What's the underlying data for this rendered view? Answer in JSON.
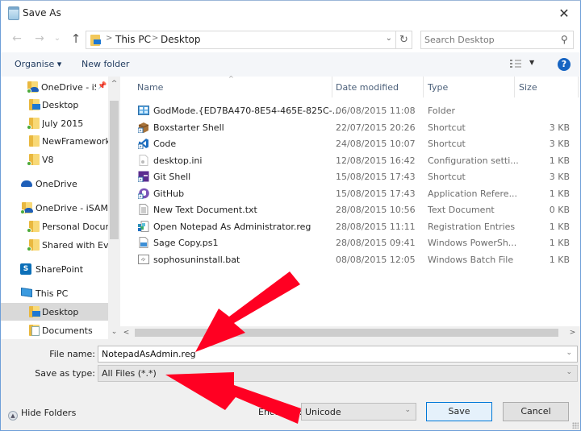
{
  "window": {
    "title": "Save As",
    "close_icon": "close-icon"
  },
  "nav": {
    "back_icon": "←",
    "forward_icon": "→",
    "recent_icon": "⌄",
    "up_icon": "↑",
    "breadcrumb": [
      "This PC",
      "Desktop"
    ],
    "breadcrumb_sep": ">",
    "address_dropdown_icon": "⌄",
    "refresh_icon": "↻",
    "search_placeholder": "Search Desktop",
    "search_icon": "⚲"
  },
  "toolbar": {
    "organise_label": "Organise ▾",
    "new_folder_label": "New folder",
    "view_dropdown_icon": "▼",
    "help_icon": "?"
  },
  "sidebar": {
    "items": [
      {
        "label": "OneDrive - iS",
        "icon": "onedrive-folder-icon",
        "pinned": true,
        "synced": true
      },
      {
        "label": "Desktop",
        "icon": "desktop-folder-icon"
      },
      {
        "label": "July 2015",
        "icon": "folder-icon",
        "synced": true
      },
      {
        "label": "NewFramework",
        "icon": "folder-icon"
      },
      {
        "label": "V8",
        "icon": "folder-icon",
        "synced": true
      },
      {
        "label": "OneDrive",
        "icon": "onedrive-cloud-icon"
      },
      {
        "label": "OneDrive - iSAMS",
        "icon": "onedrive-folder-icon",
        "synced": true
      },
      {
        "label": "Personal Documents",
        "icon": "folder-icon",
        "synced": true
      },
      {
        "label": "Shared with Everyone",
        "icon": "folder-icon",
        "synced": true
      },
      {
        "label": "SharePoint",
        "icon": "sharepoint-icon"
      },
      {
        "label": "This PC",
        "icon": "pc-icon"
      },
      {
        "label": "Desktop",
        "icon": "desktop-folder-icon",
        "selected": true
      },
      {
        "label": "Documents",
        "icon": "documents-folder-icon"
      }
    ],
    "scroll_up": "^",
    "scroll_down": "⌄"
  },
  "files": {
    "columns": {
      "name": "Name",
      "date": "Date modified",
      "type": "Type",
      "size": "Size"
    },
    "sort_indicator": "^",
    "rows": [
      {
        "name": "GodMode.{ED7BA470-8E54-465E-825C-...",
        "date": "06/08/2015 11:08",
        "type": "Folder",
        "size": "",
        "icon": "control-panel-icon"
      },
      {
        "name": "Boxstarter Shell",
        "date": "22/07/2015 20:26",
        "type": "Shortcut",
        "size": "3 KB",
        "icon": "box-shortcut-icon"
      },
      {
        "name": "Code",
        "date": "24/08/2015 10:07",
        "type": "Shortcut",
        "size": "3 KB",
        "icon": "vscode-shortcut-icon"
      },
      {
        "name": "desktop.ini",
        "date": "12/08/2015 16:42",
        "type": "Configuration setti...",
        "size": "1 KB",
        "icon": "config-file-icon"
      },
      {
        "name": "Git Shell",
        "date": "15/08/2015 17:43",
        "type": "Shortcut",
        "size": "3 KB",
        "icon": "git-shell-shortcut-icon"
      },
      {
        "name": "GitHub",
        "date": "15/08/2015 17:43",
        "type": "Application Refere...",
        "size": "1 KB",
        "icon": "github-icon"
      },
      {
        "name": "New Text Document.txt",
        "date": "28/08/2015 10:56",
        "type": "Text Document",
        "size": "0 KB",
        "icon": "text-file-icon"
      },
      {
        "name": "Open Notepad As Administrator.reg",
        "date": "28/08/2015 11:11",
        "type": "Registration Entries",
        "size": "1 KB",
        "icon": "registry-file-icon"
      },
      {
        "name": "Sage Copy.ps1",
        "date": "28/08/2015 09:41",
        "type": "Windows PowerSh...",
        "size": "1 KB",
        "icon": "powershell-file-icon"
      },
      {
        "name": "sophosuninstall.bat",
        "date": "08/08/2015 12:05",
        "type": "Windows Batch File",
        "size": "1 KB",
        "icon": "batch-file-icon"
      }
    ],
    "hscroll_left": "<",
    "hscroll_right": ">"
  },
  "form": {
    "file_name_label": "File name:",
    "file_name_value": "NotepadAsAdmin.reg",
    "save_type_label": "Save as type:",
    "save_type_value": "All Files  (*.*)",
    "dropdown_icon": "⌄",
    "hide_folders_label": "Hide Folders",
    "hide_folders_icon": "▲",
    "encoding_label": "Encoding:",
    "encoding_value": "Unicode",
    "save_label": "Save",
    "cancel_label": "Cancel"
  },
  "annotations": {
    "arrow_color": "#ff0022",
    "arrows": [
      "arrow-to-file-name",
      "arrow-to-save-as-type"
    ]
  }
}
